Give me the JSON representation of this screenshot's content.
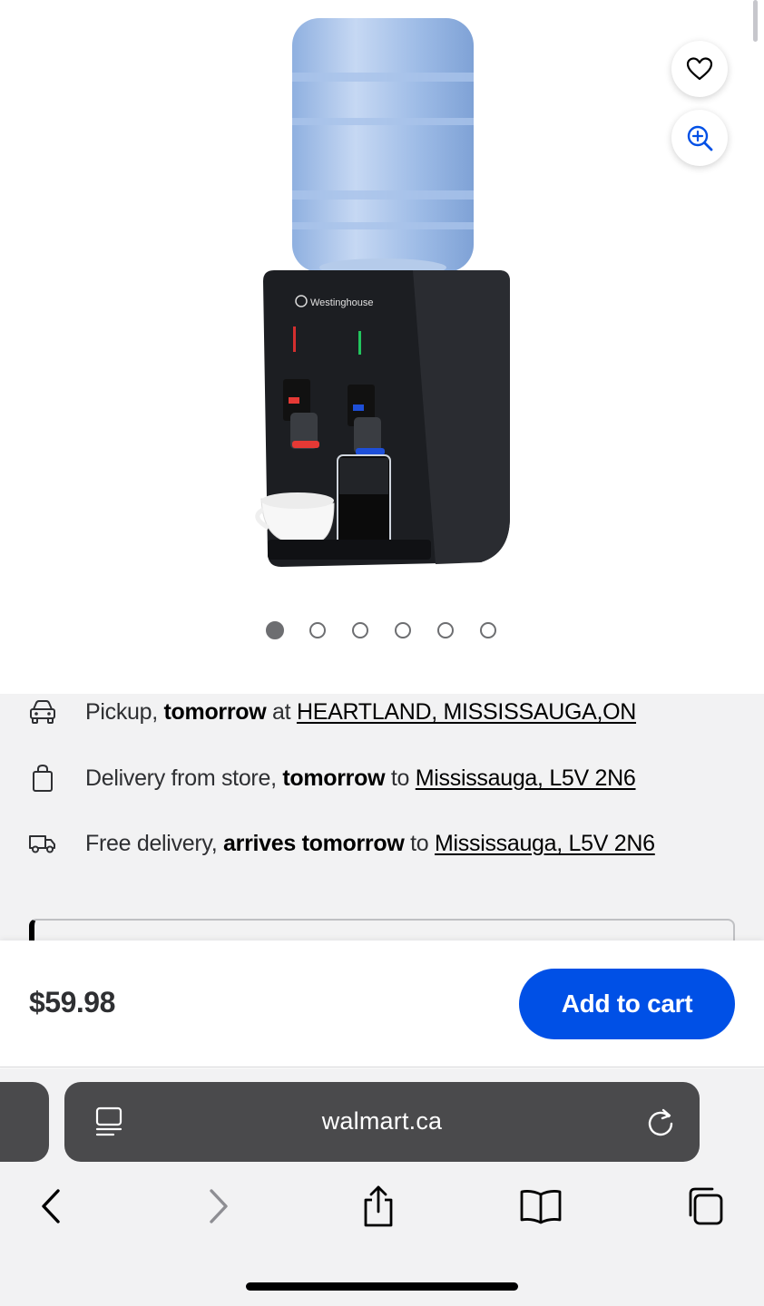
{
  "product": {
    "brand_on_image": "Westinghouse",
    "gallery_dot_count": 6,
    "gallery_active_index": 0
  },
  "fulfillment": {
    "pickup": {
      "label": "Pickup, ",
      "when": "tomorrow",
      "connector": " at ",
      "location": "HEARTLAND, MISSISSAUGA,ON"
    },
    "store_delivery": {
      "label": "Delivery from store, ",
      "when": "tomorrow",
      "connector": " to ",
      "location": "Mississauga, L5V 2N6"
    },
    "free_delivery": {
      "label": "Free delivery, ",
      "when": "arrives tomorrow",
      "connector": " to ",
      "location": "Mississauga, L5V 2N6"
    }
  },
  "purchase": {
    "price": "$59.98",
    "add_to_cart": "Add to cart"
  },
  "browser": {
    "url": "walmart.ca"
  },
  "colors": {
    "primary_blue": "#0050e6",
    "fulfillment_bg": "#f2f2f3",
    "url_bar_bg": "#4a4a4c"
  },
  "icons": [
    "heart-icon",
    "zoom-in-icon",
    "car-icon",
    "shopping-bag-icon",
    "delivery-truck-icon",
    "page-menu-icon",
    "reload-icon",
    "back-icon",
    "forward-icon",
    "share-icon",
    "bookmarks-icon",
    "tabs-icon"
  ]
}
